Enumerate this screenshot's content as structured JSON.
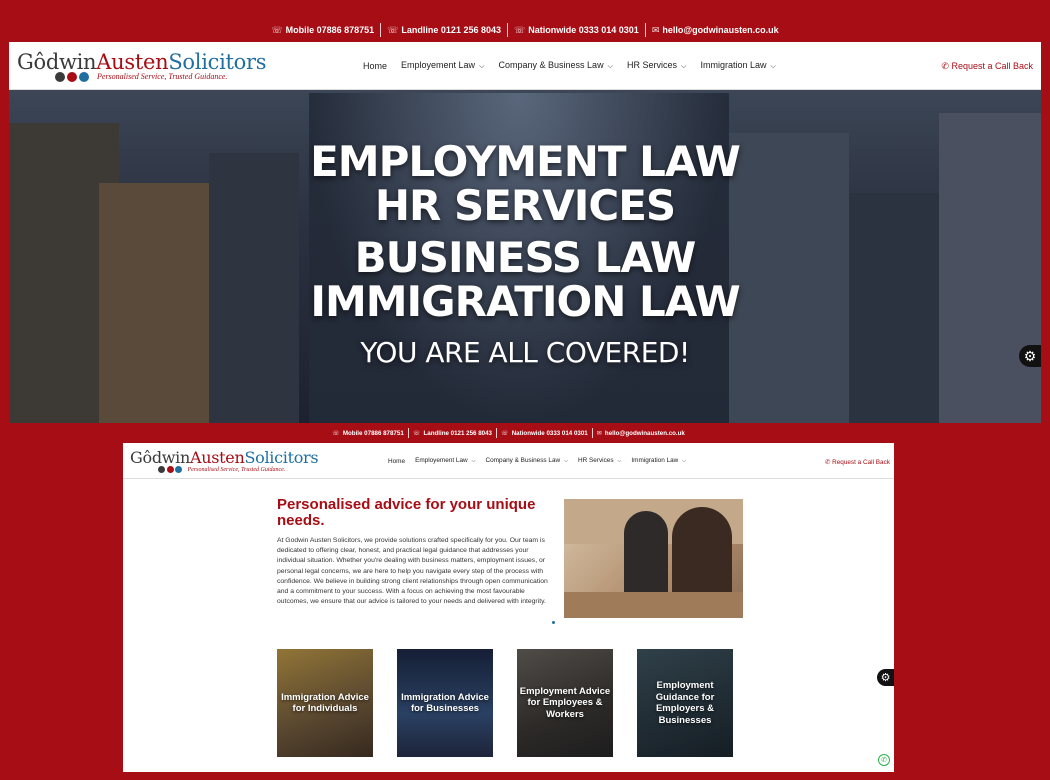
{
  "topbar": {
    "mobile": "Mobile 07886 878751",
    "landline": "Landline 0121 256 8043",
    "nationwide": "Nationwide 0333 014 0301",
    "email": "hello@godwinausten.co.uk"
  },
  "logo": {
    "part1": "Gôdwin",
    "part2": "Austen",
    "part3": "Solicitors",
    "tagline": "Personalised Service, Trusted Guidance."
  },
  "nav": {
    "items": [
      "Home",
      "Employement Law",
      "Company & Business Law",
      "HR Services",
      "Immigration Law"
    ],
    "callback": "Request a Call Back"
  },
  "hero": {
    "line1": "EMPLOYMENT LAW",
    "line2": "HR SERVICES",
    "line3": "BUSINESS LAW",
    "line4": "IMMIGRATION LAW",
    "line5": "YOU ARE ALL COVERED!"
  },
  "intro": {
    "heading": "Personalised advice for your unique needs.",
    "body": "At Godwin Austen Solicitors, we provide solutions crafted specifically for you. Our team is dedicated to offering clear, honest, and practical legal guidance that addresses your individual situation. Whether you're dealing with business matters, employment issues, or personal legal concerns, we are here to help you navigate every step of the process with confidence. We believe in building strong client relationships through open communication and a commitment to your success. With a focus on achieving the most favourable outcomes, we ensure that our advice is tailored to your needs and delivered with integrity."
  },
  "tiles": [
    "Immigration Advice for Individuals",
    "Immigration Advice for Businesses",
    "Employment Advice for Employees & Workers",
    "Employment Guidance for Employers & Businesses"
  ],
  "colors": {
    "brand_red": "#a70d15",
    "brand_blue": "#1f6fa0",
    "dark": "#3a3a3a"
  },
  "icons": {
    "phone": "phone-icon",
    "mail": "mail-icon",
    "accessibility": "accessibility-icon",
    "whatsapp": "whatsapp-icon"
  }
}
